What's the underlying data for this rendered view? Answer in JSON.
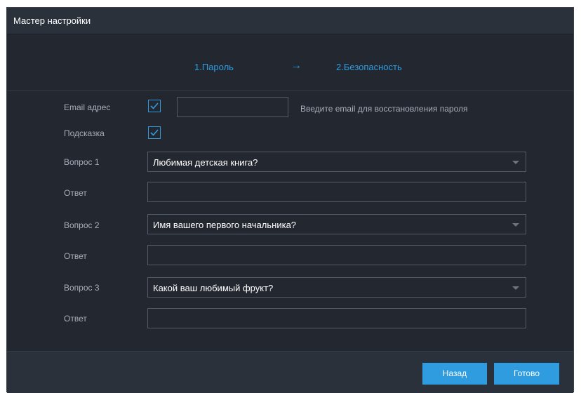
{
  "window": {
    "title": "Мастер настройки"
  },
  "steps": {
    "step1": "1.Пароль",
    "arrow": "→",
    "step2": "2.Безопасность"
  },
  "form": {
    "email": {
      "label": "Email адрес",
      "checked": true,
      "value": "",
      "hint": "Введите email для восстановления пароля"
    },
    "prompt": {
      "label": "Подсказка",
      "checked": true
    },
    "questions": [
      {
        "label": "Вопрос 1",
        "selected": "Любимая детская книга?",
        "answer_label": "Ответ",
        "answer": ""
      },
      {
        "label": "Вопрос 2",
        "selected": "Имя вашего первого начальника?",
        "answer_label": "Ответ",
        "answer": ""
      },
      {
        "label": "Вопрос 3",
        "selected": "Какой ваш любимый фрукт?",
        "answer_label": "Ответ",
        "answer": ""
      }
    ]
  },
  "buttons": {
    "back": "Назад",
    "done": "Готово"
  },
  "colors": {
    "accent": "#2f9ce0",
    "background": "#232830",
    "panel": "#2b313a",
    "label": "#a7aeb9"
  }
}
